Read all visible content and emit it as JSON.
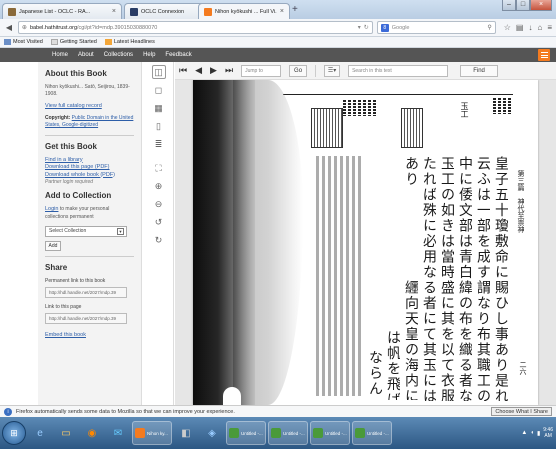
{
  "browser": {
    "tabs": [
      {
        "title": "Japanese List - OCLC - RA...",
        "fav_color": "#8a6a3a"
      },
      {
        "title": "OCLC Connexion",
        "fav_color": "#2a3d66"
      },
      {
        "title": "Nihon kyōkushi ... Full Vi...",
        "fav_color": "#f47b20"
      }
    ],
    "new_tab": "+",
    "url_host": "babel.hathitrust.org",
    "url_path": "/cgi/pt?id=mdp.39015030880070",
    "search_placeholder": "Google",
    "search_engine_letter": "8",
    "bookmarks": [
      {
        "label": "Most Visited"
      },
      {
        "label": "Getting Started"
      },
      {
        "label": "Latest Headlines"
      }
    ]
  },
  "site_nav": {
    "items": [
      "Home",
      "About",
      "Collections",
      "Help",
      "Feedback"
    ]
  },
  "sidebar": {
    "about_title": "About this Book",
    "book_meta": "Nihon kyōkushi... Satō, Seijirou, 1839-1908.",
    "full_record": "View full catalog record",
    "copyright_label": "Copyright:",
    "copyright_link": "Public Domain in the United States, Google-digitized",
    "get_title": "Get this Book",
    "find_library": "Find in a library",
    "download_page": "Download this page (PDF)",
    "download_book": "Download whole book (PDF)",
    "partner_login": "Partner login required",
    "collection_title": "Add to Collection",
    "login_text": "to make your personal collections permanent",
    "login_link": "Login",
    "select_collection": "Select Collection",
    "add_button": "Add",
    "share_title": "Share",
    "permanent_label": "Permanent link to this book",
    "permanent_value": "http://hdl.handle.net/2027/mdp.39",
    "page_label": "Link to this page",
    "page_value": "http://hdl.handle.net/2027/mdp.39",
    "embed": "Embed this book"
  },
  "viewer": {
    "jump_placeholder": "Jump to",
    "go_label": "Go",
    "search_placeholder": "Search in this text",
    "find_label": "Find",
    "columns": [
      "皇子五十瓊敷命に賜ひし事あり是れ作",
      "云ふは一部を成す謂なり布其職工の多",
      "中に倭文部は青白緯の布を織る者なり",
      "玉工の如きは當時盛に其を以て衣服装",
      "たれば殊に必用なる者にて其玉には曲",
      "あり",
      "纒向天皇の海内に命して",
      "は帆を飛ばして",
      "ならん"
    ],
    "header_right": "第三篇　神代至崇神",
    "header_small": "工藝",
    "page_number": "二六",
    "small_col": "玉工"
  },
  "status": {
    "notification": "Firefox automatically sends some data to Mozilla so that we can improve your experience.",
    "choose": "Choose What I Share"
  },
  "taskbar": {
    "items": [
      {
        "label": "Nihon ky...",
        "color": "#f47b20"
      },
      {
        "label": "Untitled -...",
        "color": "#4a9a3a"
      },
      {
        "label": "Untitled -...",
        "color": "#4a9a3a"
      },
      {
        "label": "Untitled -...",
        "color": "#4a9a3a"
      },
      {
        "label": "Untitled -...",
        "color": "#4a9a3a"
      }
    ],
    "time": "9:46",
    "date": "AM"
  }
}
